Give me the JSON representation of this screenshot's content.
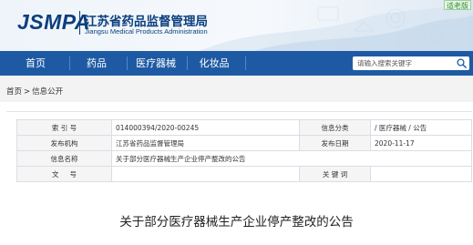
{
  "header": {
    "logo": "JSMPA",
    "org_cn": "江苏省药品监督管理局",
    "org_en": "Jiangsu Medical Products Administration",
    "aging_badge": "适老版"
  },
  "nav": {
    "items": [
      {
        "label": "首页"
      },
      {
        "label": "药品"
      },
      {
        "label": "医疗器械"
      },
      {
        "label": "化妆品"
      }
    ],
    "search_placeholder": "请输入搜索关键字"
  },
  "breadcrumb": {
    "home": "首页",
    "separator": ">",
    "current": "信息公开"
  },
  "info": {
    "rows": [
      {
        "label1": "索 引 号",
        "value1": "014000394/2020-00245",
        "label2": "信息分类",
        "value2": "/  医疗器械  /  公告"
      },
      {
        "label1": "发布机构",
        "value1": "江苏省药品监督管理局",
        "label2": "发布日期",
        "value2": "2020-11-17"
      },
      {
        "label1": "信息名称",
        "value1": "关于部分医疗器械生产企业停产整改的公告"
      },
      {
        "label1": "文     号",
        "value1": "",
        "label2": "关 键 词",
        "value2": ""
      }
    ]
  },
  "article": {
    "title": "关于部分医疗器械生产企业停产整改的公告"
  },
  "colors": {
    "nav_bg": "#1e5aa3",
    "brand": "#0b3f7d"
  }
}
